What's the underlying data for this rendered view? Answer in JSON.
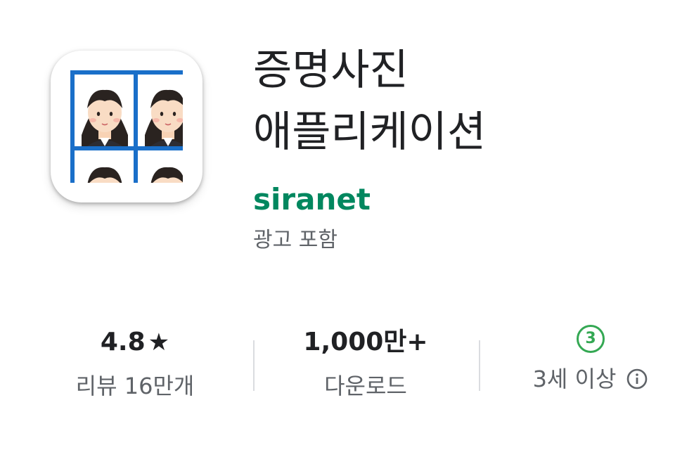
{
  "app": {
    "title_line1": "증명사진",
    "title_line2": "애플리케이션",
    "developer": "siranet",
    "ad_notice": "광고 포함"
  },
  "stats": {
    "rating": {
      "value": "4.8",
      "icon": "star-icon",
      "label": "리뷰 16만개"
    },
    "downloads": {
      "value": "1,000만+",
      "label": "다운로드"
    },
    "age": {
      "badge": "3",
      "label": "3세 이상",
      "icon": "info-icon"
    }
  },
  "colors": {
    "developer": "#01875f",
    "age_badge": "#34a853",
    "icon_grid": "#1a6fc9"
  }
}
